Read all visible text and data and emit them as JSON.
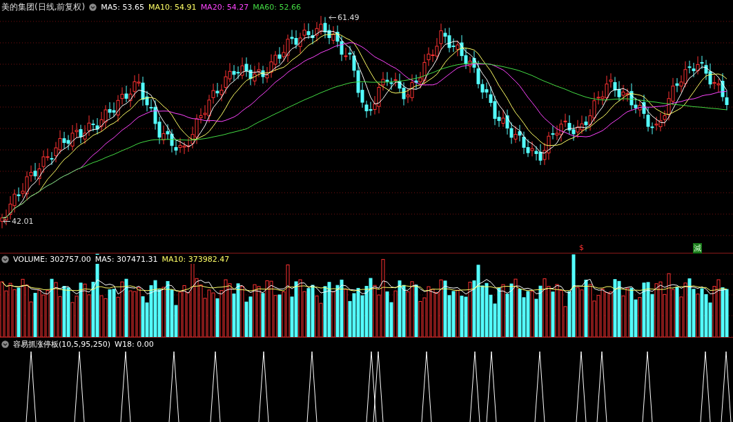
{
  "price_panel": {
    "title": "美的集团(日线,前复权)",
    "indicators": [
      {
        "label": "MA5: 53.65",
        "color": "#ffffff"
      },
      {
        "label": "MA10: 54.91",
        "color": "#ffff66"
      },
      {
        "label": "MA20: 54.27",
        "color": "#ff44ff"
      },
      {
        "label": "MA60: 52.66",
        "color": "#44dd44"
      }
    ],
    "high_label": "61.49",
    "low_label": "42.01",
    "markers": [
      {
        "text": "$",
        "kind": "dollar"
      },
      {
        "text": "減",
        "kind": "reduce"
      }
    ]
  },
  "volume_panel": {
    "indicators": [
      {
        "label": "VOLUME: 302757.00",
        "color": "#ffffff"
      },
      {
        "label": "MA5: 307471.31",
        "color": "#ffffff"
      },
      {
        "label": "MA10: 373982.47",
        "color": "#ffff66"
      }
    ]
  },
  "signal_panel": {
    "indicators": [
      {
        "label": "容易抓涨停板(10,5,95,250)",
        "color": "#ffffff"
      },
      {
        "label": "W18: 0.00",
        "color": "#ffffff"
      }
    ]
  }
}
